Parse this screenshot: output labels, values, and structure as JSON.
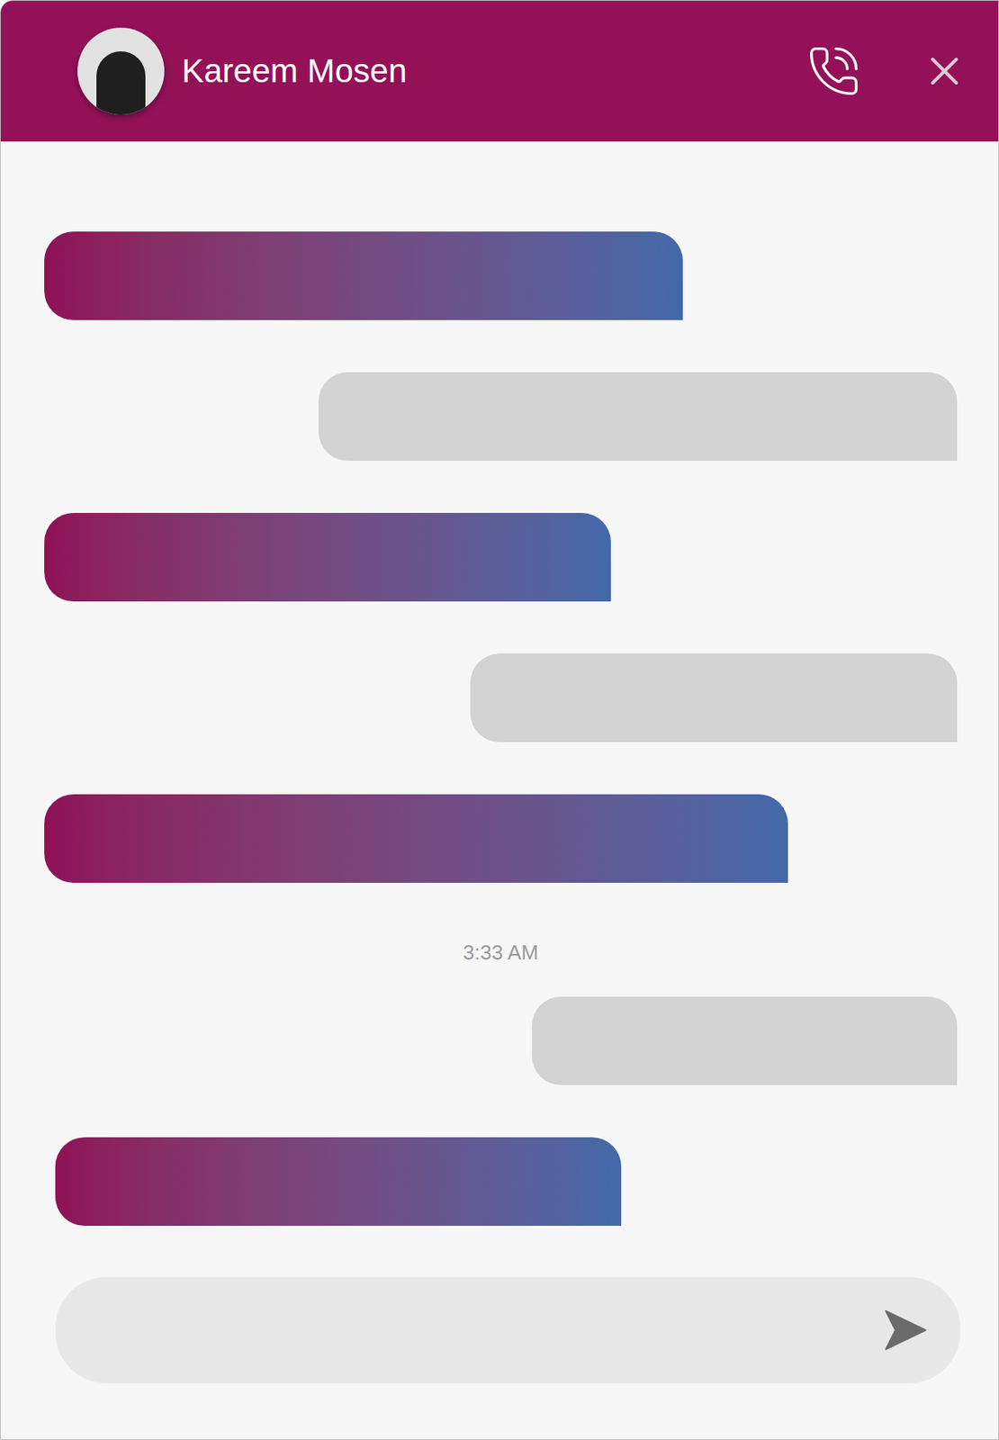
{
  "header": {
    "name": "Kareem Mosen"
  },
  "messages": [
    {
      "kind": "incoming"
    },
    {
      "kind": "outgoing"
    },
    {
      "kind": "incoming"
    },
    {
      "kind": "outgoing"
    },
    {
      "kind": "incoming"
    },
    {
      "kind": "timestamp",
      "text": "3:33 AM"
    },
    {
      "kind": "outgoing"
    },
    {
      "kind": "incoming"
    }
  ]
}
